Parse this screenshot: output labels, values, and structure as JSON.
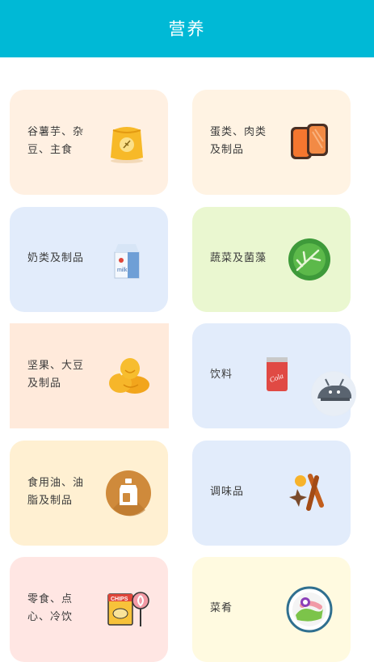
{
  "header": {
    "title": "营养"
  },
  "categories": [
    {
      "label": "谷薯芋、杂\n豆、主食",
      "icon": "grain-bag-icon"
    },
    {
      "label": "蛋类、肉类\n及制品",
      "icon": "meat-slices-icon"
    },
    {
      "label": "奶类及制品",
      "icon": "milk-carton-icon"
    },
    {
      "label": "蔬菜及菌藻",
      "icon": "cabbage-icon"
    },
    {
      "label": "坚果、大豆\n及制品",
      "icon": "nuts-icon"
    },
    {
      "label": "饮料",
      "icon": "cola-can-icon"
    },
    {
      "label": "食用油、油\n脂及制品",
      "icon": "oil-bottle-icon"
    },
    {
      "label": "调味品",
      "icon": "spices-icon"
    },
    {
      "label": "零食、点\n心、冷饮",
      "icon": "chips-candy-icon"
    },
    {
      "label": "菜肴",
      "icon": "dish-icon"
    }
  ],
  "colors": {
    "header": "#00b9d6"
  }
}
